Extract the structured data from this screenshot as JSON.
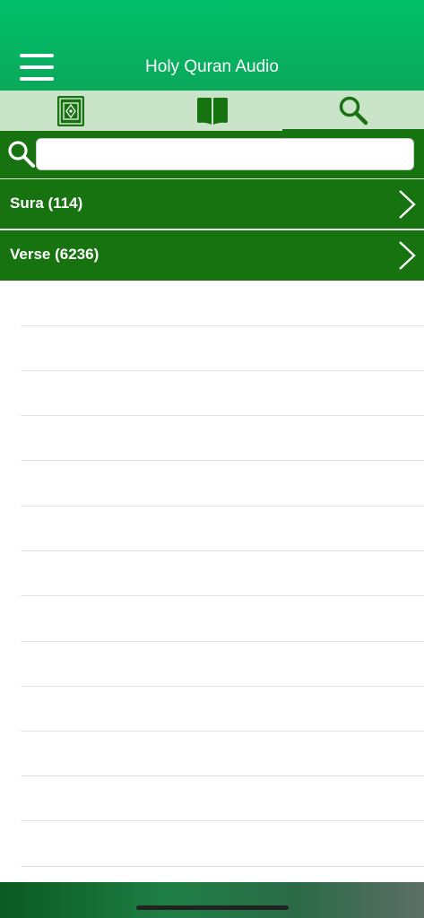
{
  "header": {
    "title": "Holy Quran Audio"
  },
  "tabs": [
    {
      "name": "quran-book-tab",
      "icon": "quran-book-icon"
    },
    {
      "name": "open-book-tab",
      "icon": "open-book-icon"
    },
    {
      "name": "search-tab",
      "icon": "search-icon",
      "active": true
    }
  ],
  "search": {
    "value": "",
    "placeholder": ""
  },
  "list": [
    {
      "label": "Sura (114)"
    },
    {
      "label": "Verse (6236)"
    }
  ],
  "colors": {
    "header": "#00c06a",
    "tabbar": "#c9e4c9",
    "primary": "#17730f"
  }
}
